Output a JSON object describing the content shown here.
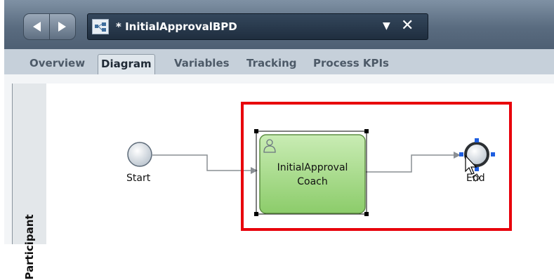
{
  "document": {
    "title": "* InitialApprovalBPD",
    "icon": "process-diagram-icon"
  },
  "tabs": [
    {
      "label": "Overview",
      "active": false
    },
    {
      "label": "Diagram",
      "active": true
    },
    {
      "label": "Variables",
      "active": false
    },
    {
      "label": "Tracking",
      "active": false
    },
    {
      "label": "Process KPIs",
      "active": false
    }
  ],
  "lane": {
    "label": "Participant"
  },
  "diagram": {
    "start_label": "Start",
    "activity_label_line1": "InitialApproval",
    "activity_label_line2": "Coach",
    "activity_icon": "user-icon",
    "end_label": "End"
  },
  "colors": {
    "highlight": "#e8000b",
    "activity_fill": "#a9d98c",
    "event_fill": "#d7dde3"
  }
}
